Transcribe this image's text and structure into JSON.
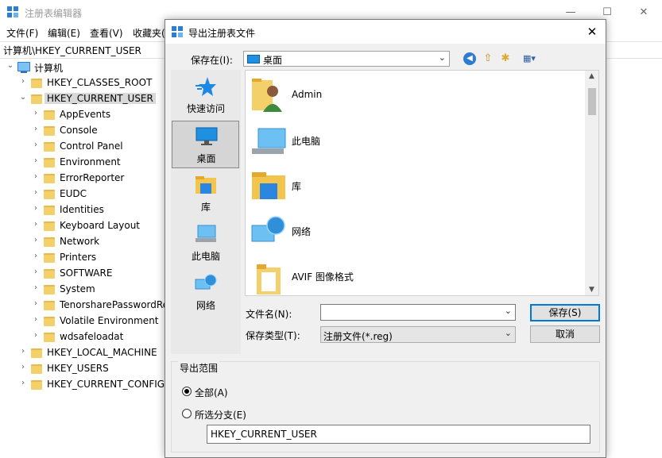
{
  "registry_editor": {
    "title": "注册表编辑器",
    "window_controls": [
      "—",
      "☐",
      "✕"
    ],
    "menu": [
      "文件(F)",
      "编辑(E)",
      "查看(V)",
      "收藏夹("
    ],
    "address": "计算机\\HKEY_CURRENT_USER",
    "tree": {
      "root": "计算机",
      "hives": [
        {
          "label": "HKEY_CLASSES_ROOT",
          "expanded": false
        },
        {
          "label": "HKEY_CURRENT_USER",
          "expanded": true,
          "selected": true
        },
        {
          "label": "HKEY_LOCAL_MACHINE",
          "expanded": false
        },
        {
          "label": "HKEY_USERS",
          "expanded": false
        },
        {
          "label": "HKEY_CURRENT_CONFIG",
          "expanded": false
        }
      ],
      "current_user_children": [
        "AppEvents",
        "Console",
        "Control Panel",
        "Environment",
        "ErrorReporter",
        "EUDC",
        "Identities",
        "Keyboard Layout",
        "Network",
        "Printers",
        "SOFTWARE",
        "System",
        "TenorsharePasswordRe",
        "Volatile Environment",
        "wdsafeloadat"
      ]
    }
  },
  "dialog": {
    "title": "导出注册表文件",
    "close_glyph": "✕",
    "save_in_label": "保存在(I):",
    "save_in_value": "桌面",
    "places": [
      {
        "label": "快速访问",
        "icon": "star-icon"
      },
      {
        "label": "桌面",
        "icon": "desktop-icon"
      },
      {
        "label": "库",
        "icon": "library-icon"
      },
      {
        "label": "此电脑",
        "icon": "computer-icon"
      },
      {
        "label": "网络",
        "icon": "network-icon"
      }
    ],
    "files": [
      {
        "name": "Admin",
        "icon": "user-folder-icon"
      },
      {
        "name": "此电脑",
        "icon": "computer-icon"
      },
      {
        "name": "库",
        "icon": "library-icon"
      },
      {
        "name": "网络",
        "icon": "network-icon"
      },
      {
        "name": "AVIF 图像格式",
        "icon": "folder-icon"
      }
    ],
    "filename_label": "文件名(N):",
    "filename_value": "",
    "filetype_label": "保存类型(T):",
    "filetype_value": "注册文件(*.reg)",
    "save_button": "保存(S)",
    "cancel_button": "取消",
    "export_range": {
      "title": "导出范围",
      "all_label": "全部(A)",
      "all_checked": true,
      "branch_label": "所选分支(E)",
      "branch_checked": false,
      "branch_value": "HKEY_CURRENT_USER"
    }
  },
  "colors": {
    "accent": "#0078d7",
    "folder": "#f3d06a",
    "dialog_bg": "#f0f0f0"
  }
}
